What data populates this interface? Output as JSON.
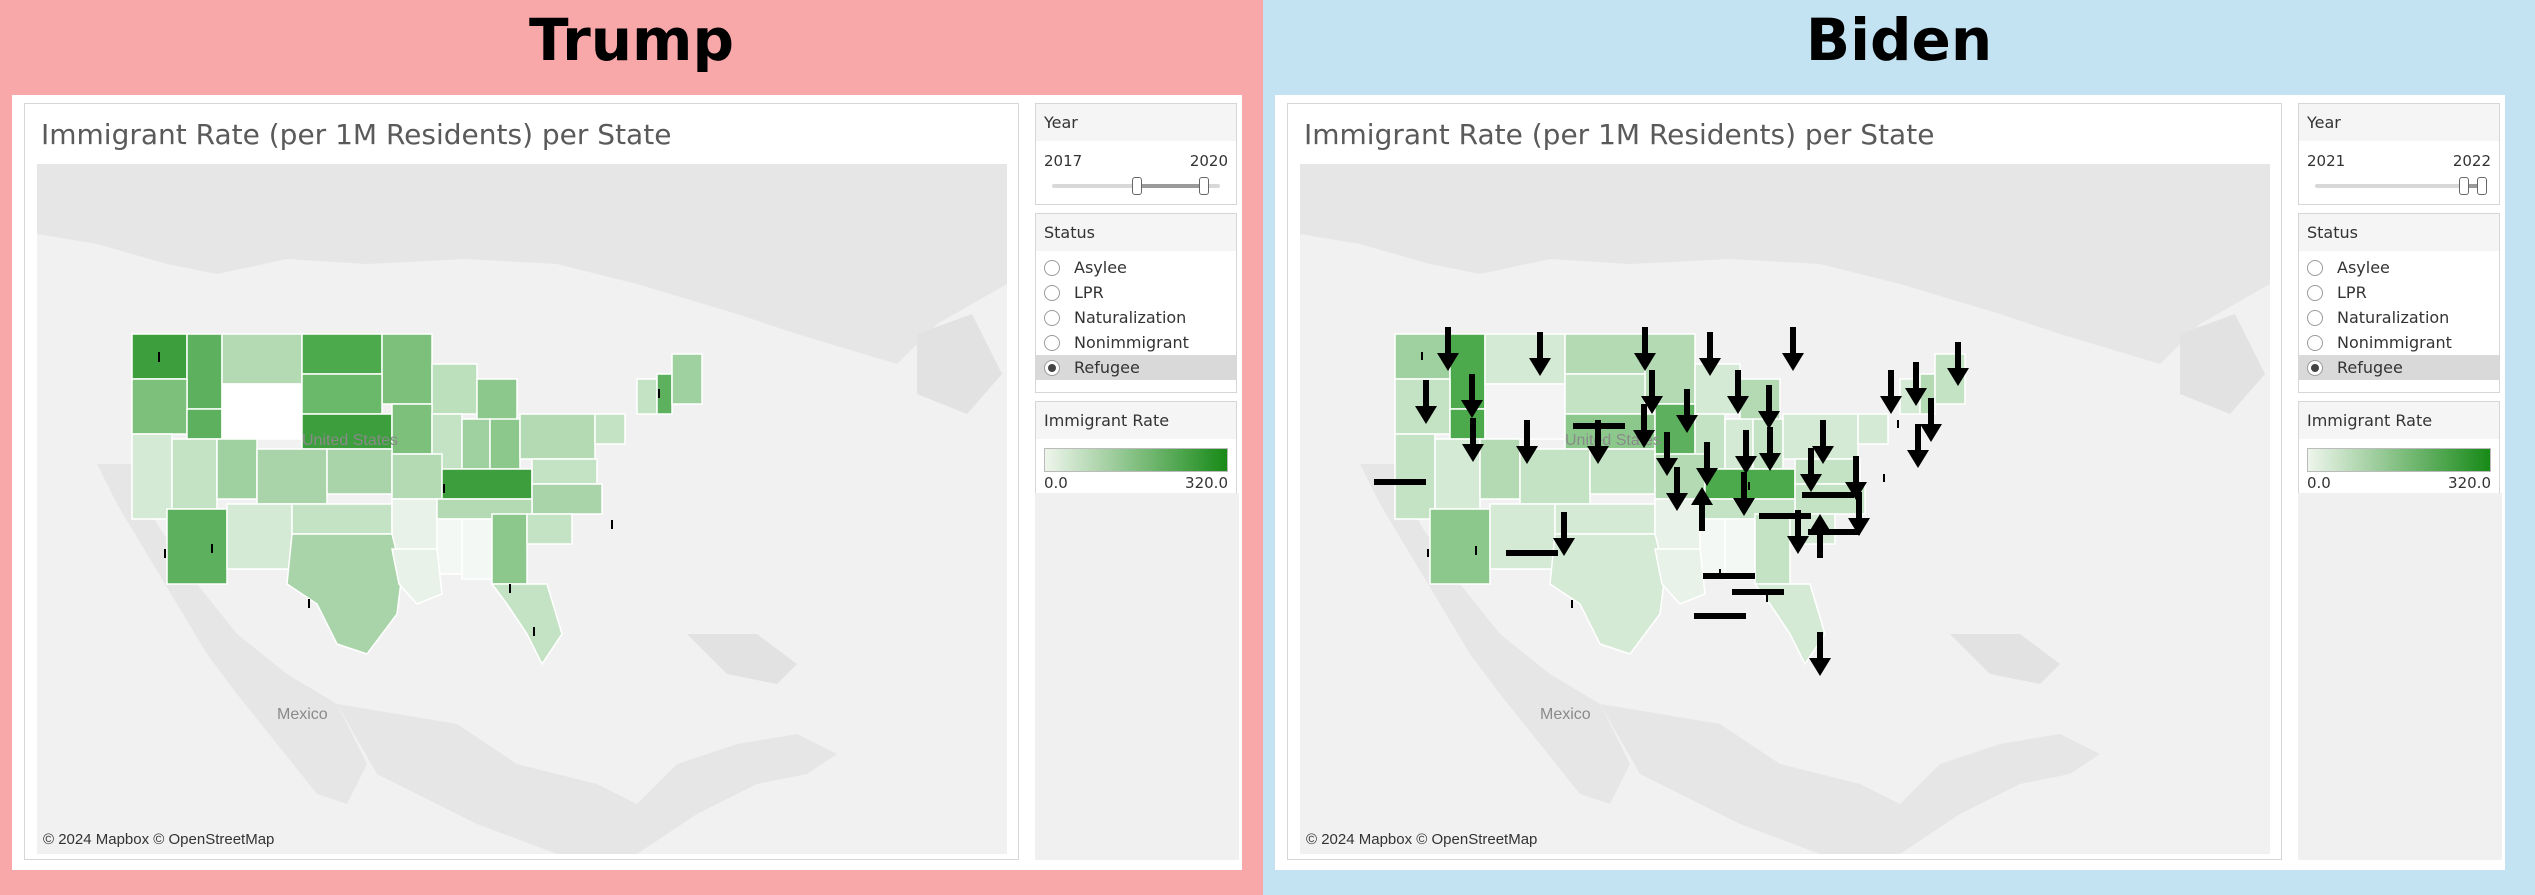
{
  "panels": [
    {
      "header": "Trump",
      "map_title": "Immigrant Rate (per 1M Residents) per State",
      "attribution": "© 2024 Mapbox © OpenStreetMap",
      "country_label": "United States",
      "mexico_label": "Mexico",
      "year": {
        "title": "Year",
        "min": "2017",
        "max": "2020",
        "range_start_fraction": 0.5,
        "range_end_fraction": 0.9
      },
      "status": {
        "title": "Status",
        "options": [
          "Asylee",
          "LPR",
          "Naturalization",
          "Nonimmigrant",
          "Refugee"
        ],
        "selected": "Refugee"
      },
      "legend": {
        "title": "Immigrant Rate",
        "min": "0.0",
        "max": "320.0",
        "color_low": "#eef5ec",
        "color_high": "#178a17"
      }
    },
    {
      "header": "Biden",
      "map_title": "Immigrant Rate (per 1M Residents) per State",
      "attribution": "© 2024 Mapbox © OpenStreetMap",
      "country_label": "United States",
      "mexico_label": "Mexico",
      "year": {
        "title": "Year",
        "min": "2021",
        "max": "2022",
        "range_start_fraction": 0.88,
        "range_end_fraction": 1.0
      },
      "status": {
        "title": "Status",
        "options": [
          "Asylee",
          "LPR",
          "Naturalization",
          "Nonimmigrant",
          "Refugee"
        ],
        "selected": "Refugee"
      },
      "legend": {
        "title": "Immigrant Rate",
        "min": "0.0",
        "max": "320.0",
        "color_low": "#eef5ec",
        "color_high": "#178a17"
      }
    }
  ],
  "colors": {
    "left_bg": "#f9a8aa",
    "right_bg": "#c3e3f3",
    "arrow": "#000000"
  }
}
